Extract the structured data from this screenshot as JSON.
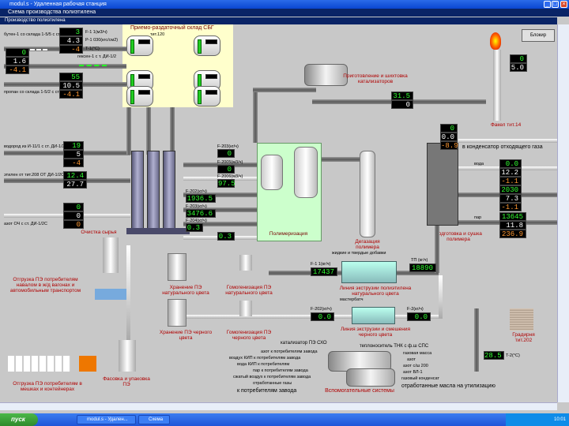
{
  "window": {
    "title": "modul.s - Удаленная рабочая станция",
    "subtitle": "Схема производства полиэтилена",
    "section": "Производство полиэтилена",
    "min": "_",
    "max": "□",
    "close": "×"
  },
  "buttons": {
    "block": "Блокир"
  },
  "labels": {
    "storage": "Приемо-раздаточный склад СБГ",
    "storage_sub": "тит.120",
    "butene": "бутен-1 со склада 1-5/5 с ст. ДИ-1/2С",
    "propane": "пропан со склада 1-5/2 с ст. ДИ-1/2С",
    "hexene": "гексен-1 с т. ДИ-1/2",
    "hydrogen": "водород из И-11/1 с ст. ДИ-1/2С",
    "ethylene": "этилен от тит.208 ОТ ДИ-1/2С",
    "nitrogen": "азот ОЧ с ст. ДИ-1/2С",
    "purification": "Очистка сырья",
    "polymerization": "Полимеризация",
    "degassing": "Дегазация полимера",
    "prep": "Приготовление и шихтовка катализаторов",
    "flare": "Факел тит.14",
    "drying": "Подготовка и сушка полимера",
    "extrusion_nat": "Линия экструзии полиэтилена натурального цвета",
    "extrusion_blk": "Линия экструзии и смешения черного цвета",
    "storage_nat": "Хранение ПЭ натурального цвета",
    "storage_blk": "Хранение ПЭ черного цвета",
    "homog_nat": "Гомогенизация ПЭ натурального цвета",
    "homog_blk": "Гомогенизация ПЭ черного цвета",
    "ship_bulk": "Отгрузка ПЭ потребителям навалом в ж/д вагонах и автомобильным транспортом",
    "ship_pack": "Отгрузка ПЭ потребителям в мешках и контейнерах",
    "packing": "Фасовка и упаковка ПЭ",
    "aux": "Вспомогательные системы",
    "tnk": "теплоноситель ТНК с ф.ш СПС",
    "catalyst": "катализатор ПЭ СХО",
    "silo": "Градирня тит.202",
    "additives": "жидкие и твердые добавки",
    "masterbatch": "мастербатч",
    "condenser": "в конденсатор отходящего газа",
    "steam": "пар",
    "water": "вода",
    "aux_left": [
      "азот к потребителям завода",
      "воздух КИП к потребителям завода",
      "вода КИП к потребителям",
      "пар к потребителям завода",
      "сжатый воздух к потребителям завода",
      "отработанные газы",
      "к потребителям завода"
    ],
    "aux_right": [
      "газовая масса",
      "азот",
      "азот с/ш 200",
      "азот ВЛ-1",
      "газовый конденсат",
      "отработанные масла на утилизацию"
    ]
  },
  "displays": {
    "d1": "3",
    "d2": "4.3",
    "d3": "-4",
    "d4": "0",
    "d5": "1.6",
    "d6": "-4.1",
    "d7": "55",
    "d8": "10.5",
    "d9": "-4.1",
    "d10": "19",
    "d11": "5",
    "d12": "-4",
    "d13": "12.4",
    "d14": "27.7",
    "d15": "0",
    "d16": "0",
    "d17": "0",
    "r1": "0",
    "r2": "0",
    "r3": "97.5",
    "r4": "1936.5",
    "r5": "3476.6",
    "r6": "0.3",
    "r7": "0.3",
    "e1": "17437",
    "e2": "18890",
    "e3": "0.0",
    "e4": "0.0",
    "f1": "0",
    "f2": "0.0",
    "f3": "-8.9",
    "f4": "0.0",
    "f5": "12.2",
    "f6": "-1.1",
    "f7": "2030",
    "f8": "7.3",
    "f9": "-1.1",
    "f10": "13645",
    "f11": "11.8",
    "f12": "236.9",
    "g1": "0",
    "g2": "5.0",
    "p1": "31.5",
    "p2": "0",
    "t1": "28.5"
  },
  "tags": {
    "d1": "F-1 1(м3/ч)",
    "d2": "P-1 030(кгс/см2)",
    "d3": "T-1(°C)",
    "r1": "F-203(кг/ч)",
    "r2": "F-2005(м3/ч)",
    "r3": "F-2006(м3/ч)",
    "r4": "F-202(кг/ч)",
    "r5": "F-203(кг/ч)",
    "r6": "F-204(кг/ч)",
    "e1": "F-1 1(кг/ч)",
    "e2": "ТП (кг/ч)",
    "e3": "F-202(кг/ч)",
    "e4": "F-2(кг/ч)",
    "t1": "T-2(°C)"
  },
  "taskbar": {
    "start": "пуск",
    "tasks": [
      "modul.s - Удален...",
      "Схема"
    ],
    "clock": "10:01"
  },
  "colors": {
    "titlebar": "#0a46d0",
    "panel": "#c8c8c8",
    "display_text": "#33ff33",
    "label_red": "#b00000",
    "polymer_area": "#ccffcc",
    "storage_area": "#ffffcc"
  }
}
